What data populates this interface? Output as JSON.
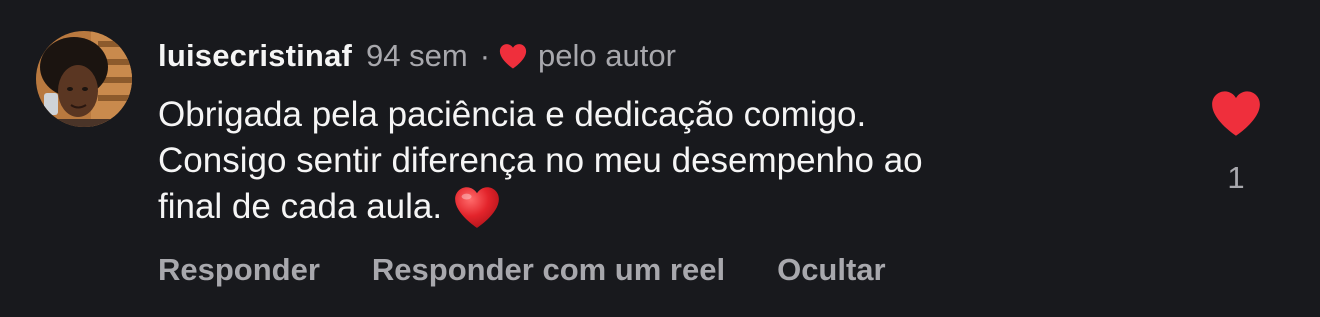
{
  "comment": {
    "username": "luisecristinaf",
    "time": "94 sem",
    "separator": "·",
    "liked_by_author_label": "pelo autor",
    "body_lines": [
      "Obrigada pela paciência e dedicação comigo.",
      "Consigo sentir diferença no meu desempenho ao",
      "final de cada aula."
    ],
    "like_count": "1",
    "actions": {
      "reply": "Responder",
      "reply_with_reel": "Responder com um reel",
      "hide": "Ocultar"
    }
  },
  "icons": {
    "author_heart": "heart-icon",
    "like": "heart-filled-icon",
    "emoji": "red-heart-emoji"
  },
  "colors": {
    "background": "#18191d",
    "heart_red": "#ef2f3c",
    "muted_text": "#a8a8ad",
    "primary_text": "#f5f5f5"
  }
}
